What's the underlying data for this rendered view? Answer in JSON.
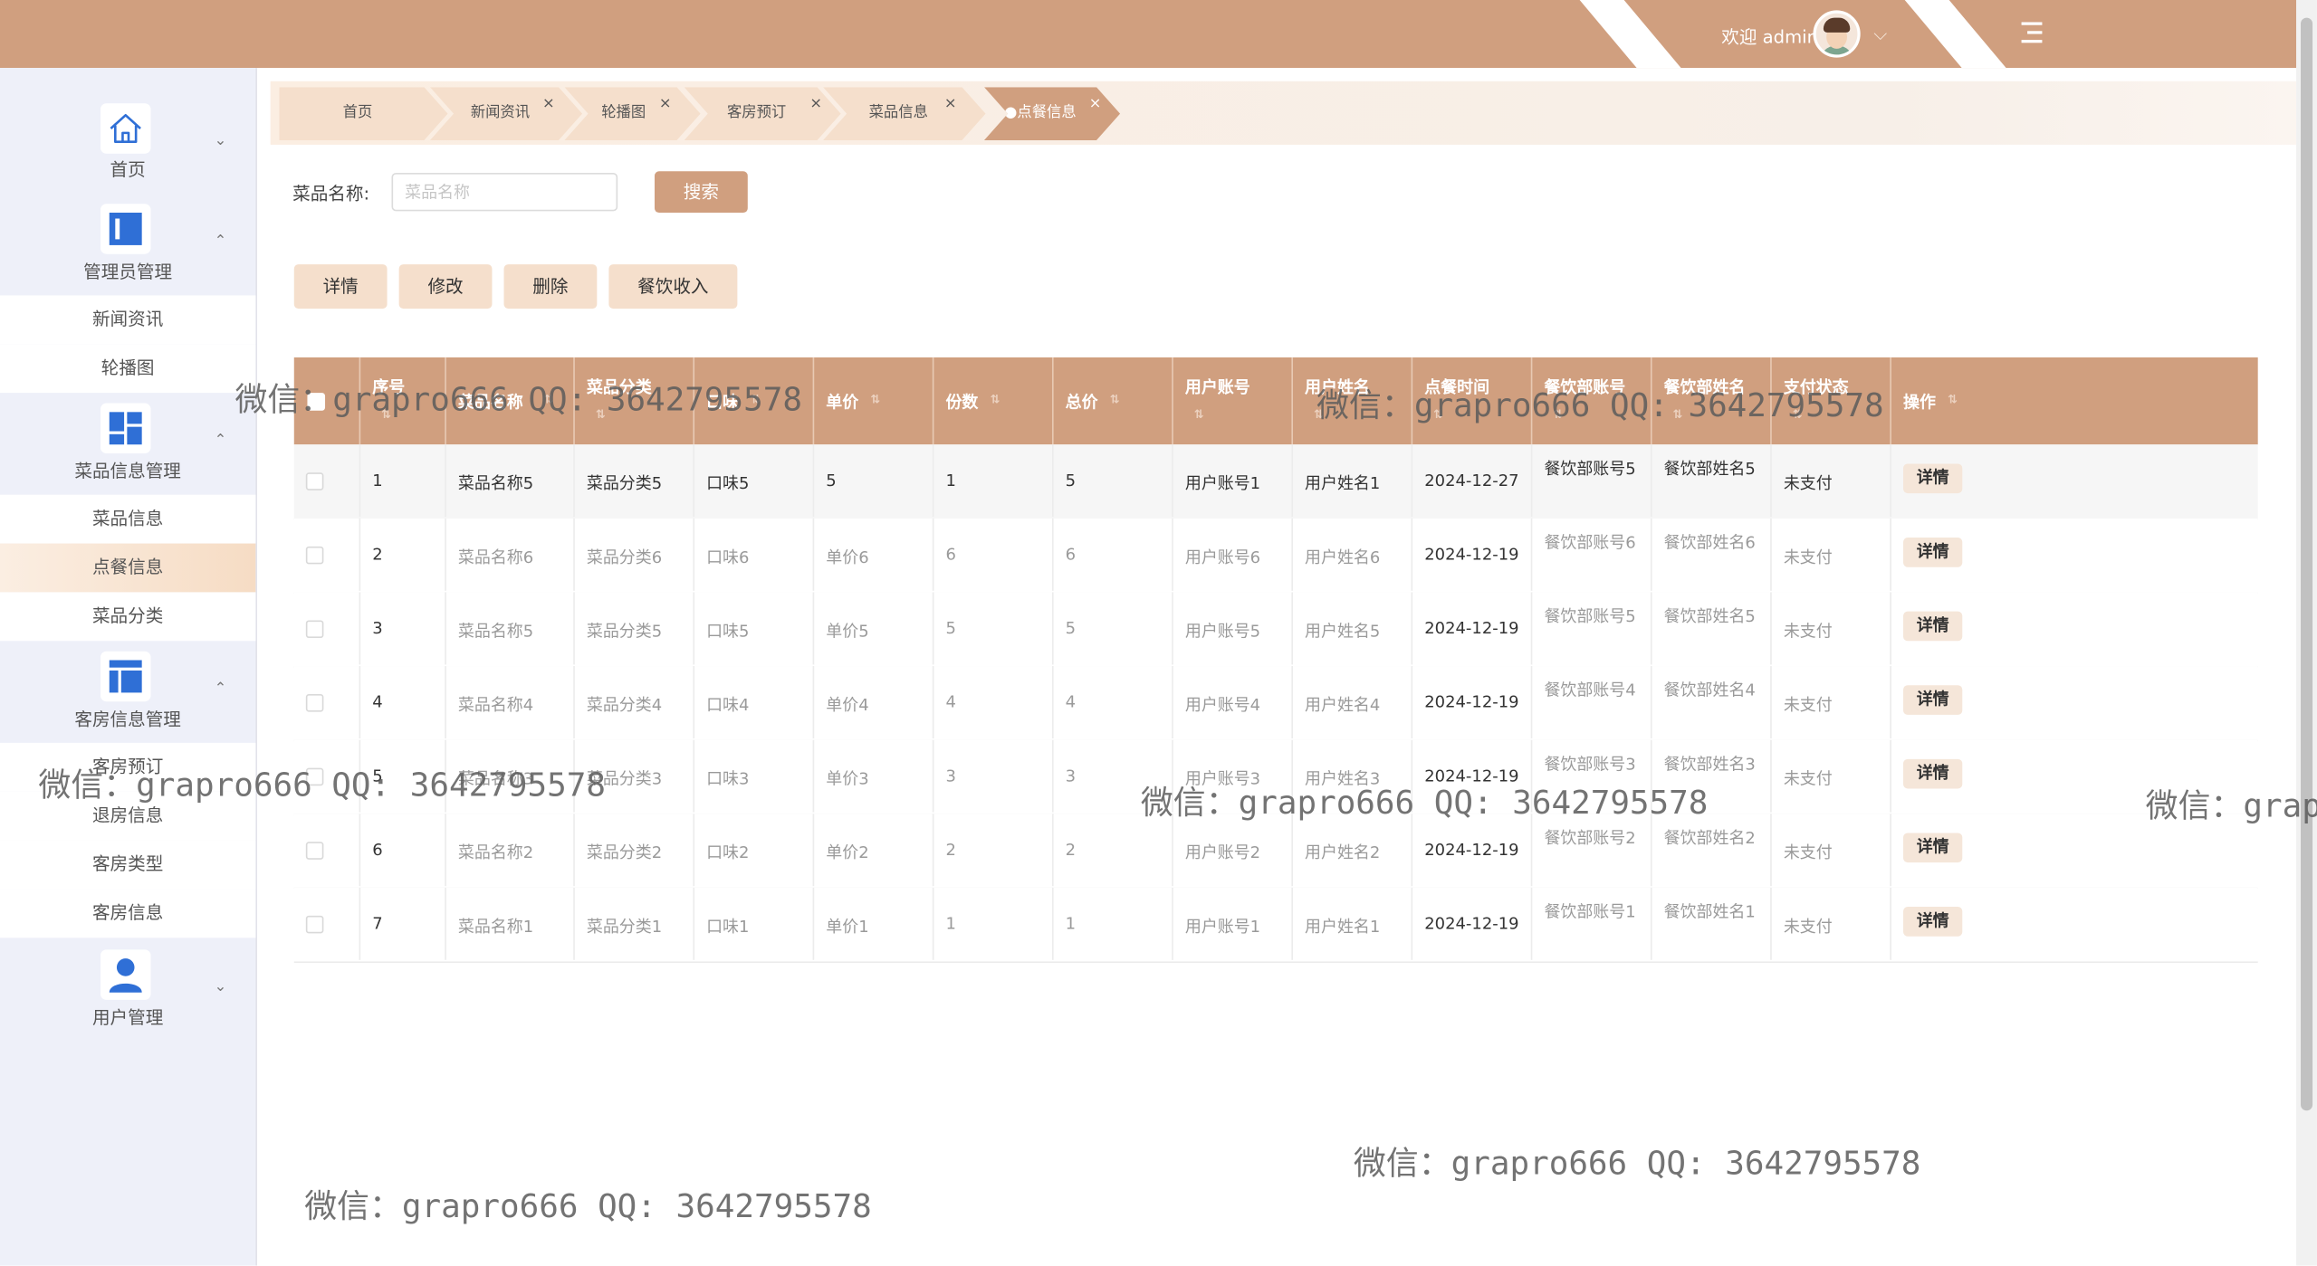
{
  "topbar": {
    "welcome": "欢迎 admin",
    "caret": "⌵"
  },
  "sidebar": {
    "groups": [
      {
        "label": "首页",
        "caret": "⌄"
      },
      {
        "label": "管理员管理",
        "caret": "⌃",
        "items": [
          "新闻资讯",
          "轮播图"
        ]
      },
      {
        "label": "菜品信息管理",
        "caret": "⌃",
        "items": [
          "菜品信息",
          "点餐信息",
          "菜品分类"
        ]
      },
      {
        "label": "客房信息管理",
        "caret": "⌃",
        "items": [
          "客房预订",
          "退房信息",
          "客房类型",
          "客房信息"
        ]
      },
      {
        "label": "用户管理",
        "caret": "⌄"
      }
    ]
  },
  "tabs": [
    {
      "label": "首页",
      "close": ""
    },
    {
      "label": "新闻资讯",
      "close": "×"
    },
    {
      "label": "轮播图",
      "close": "×"
    },
    {
      "label": "客房预订",
      "close": "×"
    },
    {
      "label": "菜品信息",
      "close": "×"
    },
    {
      "label": "●点餐信息",
      "close": "×"
    }
  ],
  "search": {
    "label": "菜品名称:",
    "placeholder": "菜品名称",
    "button": "搜索"
  },
  "actions": [
    "详情",
    "修改",
    "删除",
    "餐饮收入"
  ],
  "table": {
    "headers": [
      "序号",
      "菜品名称",
      "菜品分类",
      "口味",
      "单价",
      "份数",
      "总价",
      "用户账号",
      "用户姓名",
      "点餐时间",
      "餐饮部账号",
      "餐饮部姓名",
      "支付状态",
      "操作"
    ],
    "sort_icon": "⇅",
    "detail_label": "详情",
    "rows": [
      [
        "1",
        "菜品名称5",
        "菜品分类5",
        "口味5",
        "5",
        "1",
        "5",
        "用户账号1",
        "用户姓名1",
        "2024-12-27",
        "餐饮部账号5",
        "餐饮部姓名5",
        "未支付"
      ],
      [
        "2",
        "菜品名称6",
        "菜品分类6",
        "口味6",
        "单价6",
        "6",
        "6",
        "用户账号6",
        "用户姓名6",
        "2024-12-19",
        "餐饮部账号6",
        "餐饮部姓名6",
        "未支付"
      ],
      [
        "3",
        "菜品名称5",
        "菜品分类5",
        "口味5",
        "单价5",
        "5",
        "5",
        "用户账号5",
        "用户姓名5",
        "2024-12-19",
        "餐饮部账号5",
        "餐饮部姓名5",
        "未支付"
      ],
      [
        "4",
        "菜品名称4",
        "菜品分类4",
        "口味4",
        "单价4",
        "4",
        "4",
        "用户账号4",
        "用户姓名4",
        "2024-12-19",
        "餐饮部账号4",
        "餐饮部姓名4",
        "未支付"
      ],
      [
        "5",
        "菜品名称3",
        "菜品分类3",
        "口味3",
        "单价3",
        "3",
        "3",
        "用户账号3",
        "用户姓名3",
        "2024-12-19",
        "餐饮部账号3",
        "餐饮部姓名3",
        "未支付"
      ],
      [
        "6",
        "菜品名称2",
        "菜品分类2",
        "口味2",
        "单价2",
        "2",
        "2",
        "用户账号2",
        "用户姓名2",
        "2024-12-19",
        "餐饮部账号2",
        "餐饮部姓名2",
        "未支付"
      ],
      [
        "7",
        "菜品名称1",
        "菜品分类1",
        "口味1",
        "单价1",
        "1",
        "1",
        "用户账号1",
        "用户姓名1",
        "2024-12-19",
        "餐饮部账号1",
        "餐饮部姓名1",
        "未支付"
      ]
    ]
  },
  "watermark": "微信：grapro666 QQ: 3642795578",
  "colors": {
    "accent": "#d09f7f",
    "accent_light": "#f5dfcc",
    "sidebar_bg": "#eef0f9",
    "icon_blue": "#2f6fd6"
  }
}
